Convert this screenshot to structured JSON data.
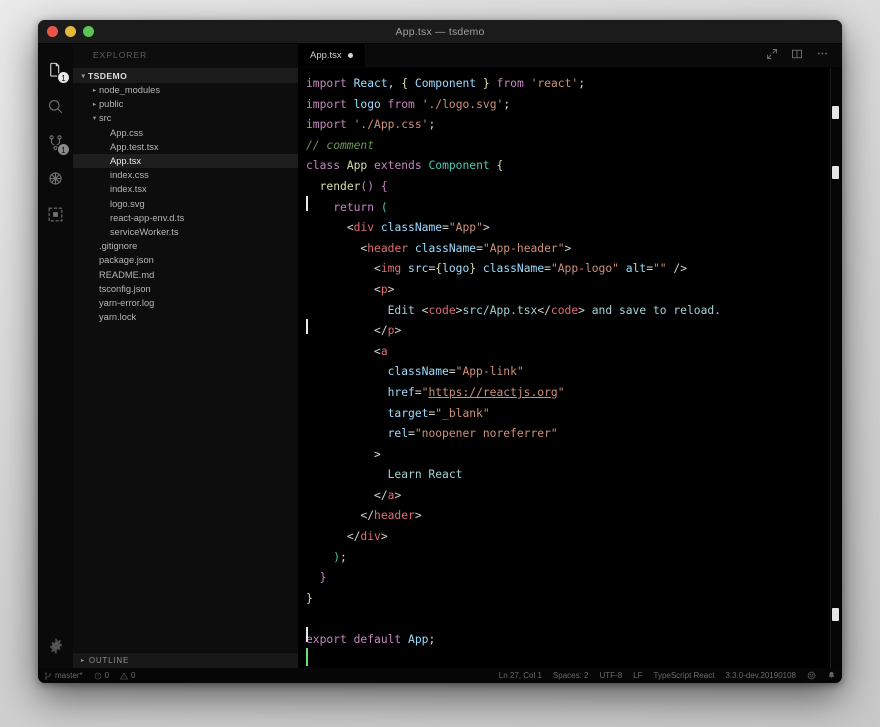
{
  "window": {
    "title": "App.tsx — tsdemo",
    "traffic_lights": [
      "close",
      "minimize",
      "zoom"
    ]
  },
  "activity_bar": {
    "items": [
      {
        "name": "explorer",
        "icon": "files-icon",
        "badge": "1",
        "active": true
      },
      {
        "name": "search",
        "icon": "search-icon",
        "badge": "",
        "active": false
      },
      {
        "name": "source-control",
        "icon": "source-control-icon",
        "badge": "1",
        "active": false
      },
      {
        "name": "debug",
        "icon": "debug-icon",
        "badge": "",
        "active": false
      },
      {
        "name": "extensions",
        "icon": "extensions-icon",
        "badge": "",
        "active": false
      }
    ],
    "bottom": {
      "name": "manage",
      "icon": "gear-icon"
    }
  },
  "sidebar": {
    "header": "EXPLORER",
    "root": {
      "label": "TSDEMO",
      "twisty": "▾"
    },
    "files": [
      {
        "label": "node_modules",
        "indent": 1,
        "twisty": "▸",
        "selected": false
      },
      {
        "label": "public",
        "indent": 1,
        "twisty": "▸",
        "selected": false
      },
      {
        "label": "src",
        "indent": 1,
        "twisty": "▾",
        "selected": false
      },
      {
        "label": "App.css",
        "indent": 2,
        "twisty": "",
        "selected": false
      },
      {
        "label": "App.test.tsx",
        "indent": 2,
        "twisty": "",
        "selected": false
      },
      {
        "label": "App.tsx",
        "indent": 2,
        "twisty": "",
        "selected": true
      },
      {
        "label": "index.css",
        "indent": 2,
        "twisty": "",
        "selected": false
      },
      {
        "label": "index.tsx",
        "indent": 2,
        "twisty": "",
        "selected": false
      },
      {
        "label": "logo.svg",
        "indent": 2,
        "twisty": "",
        "selected": false
      },
      {
        "label": "react-app-env.d.ts",
        "indent": 2,
        "twisty": "",
        "selected": false
      },
      {
        "label": "serviceWorker.ts",
        "indent": 2,
        "twisty": "",
        "selected": false
      },
      {
        "label": ".gitignore",
        "indent": 1,
        "twisty": "",
        "selected": false
      },
      {
        "label": "package.json",
        "indent": 1,
        "twisty": "",
        "selected": false
      },
      {
        "label": "README.md",
        "indent": 1,
        "twisty": "",
        "selected": false
      },
      {
        "label": "tsconfig.json",
        "indent": 1,
        "twisty": "",
        "selected": false
      },
      {
        "label": "yarn-error.log",
        "indent": 1,
        "twisty": "",
        "selected": false
      },
      {
        "label": "yarn.lock",
        "indent": 1,
        "twisty": "",
        "selected": false
      }
    ],
    "outline": {
      "label": "OUTLINE",
      "twisty": "▸"
    }
  },
  "editor": {
    "tab": {
      "label": "App.tsx",
      "dirty": true
    },
    "actions": [
      {
        "name": "split-editor-right-icon"
      },
      {
        "name": "open-changes-icon"
      },
      {
        "name": "more-actions-icon"
      }
    ],
    "language_file": "App.tsx"
  },
  "status_bar": {
    "left": [
      {
        "name": "git-branch",
        "icon": "branch-icon",
        "label": "master*"
      },
      {
        "name": "errors",
        "icon": "error-icon",
        "label": "0"
      },
      {
        "name": "warnings",
        "icon": "warning-icon",
        "label": "0"
      }
    ],
    "right": [
      {
        "name": "cursor-position",
        "label": "Ln 27, Col 1"
      },
      {
        "name": "indentation",
        "label": "Spaces: 2"
      },
      {
        "name": "encoding",
        "label": "UTF-8"
      },
      {
        "name": "eol",
        "label": "LF"
      },
      {
        "name": "language-mode",
        "label": "TypeScript React"
      },
      {
        "name": "ts-version",
        "label": "3.3.0-dev.20190108"
      },
      {
        "name": "feedback",
        "icon": "smiley-icon",
        "label": ""
      },
      {
        "name": "notifications",
        "icon": "bell-icon",
        "label": ""
      }
    ]
  },
  "code": {
    "language": "typescriptreact",
    "lines": [
      "import React, { Component } from 'react';",
      "import logo from './logo.svg';",
      "import './App.css';",
      "// comment",
      "class App extends Component {",
      "  render() {",
      "    return (",
      "      <div className=\"App\">",
      "        <header className=\"App-header\">",
      "          <img src={logo} className=\"App-logo\" alt=\"\" />",
      "          <p>",
      "            Edit <code>src/App.tsx</code> and save to reload.",
      "          </p>",
      "          <a",
      "            className=\"App-link\"",
      "            href=\"https://reactjs.org\"",
      "            target=\"_blank\"",
      "            rel=\"noopener noreferrer\"",
      "          >",
      "            Learn React",
      "          </a>",
      "        </header>",
      "      </div>",
      "    );",
      "  }",
      "}",
      "",
      "export default App;"
    ],
    "cursor_line": 27,
    "cursor_col": 1,
    "link_text": "https://reactjs.org"
  },
  "colors": {
    "background": "#000000",
    "sidebar_bg": "#0d0d0d",
    "accent_keyword": "#c586c0",
    "accent_string": "#ce9178",
    "accent_comment": "#6a9955",
    "accent_type": "#4ec9b0",
    "accent_function": "#dcdcaa",
    "accent_variable": "#9cdcfe",
    "accent_tag": "#e06c75",
    "cursor": "#6ae06a"
  }
}
